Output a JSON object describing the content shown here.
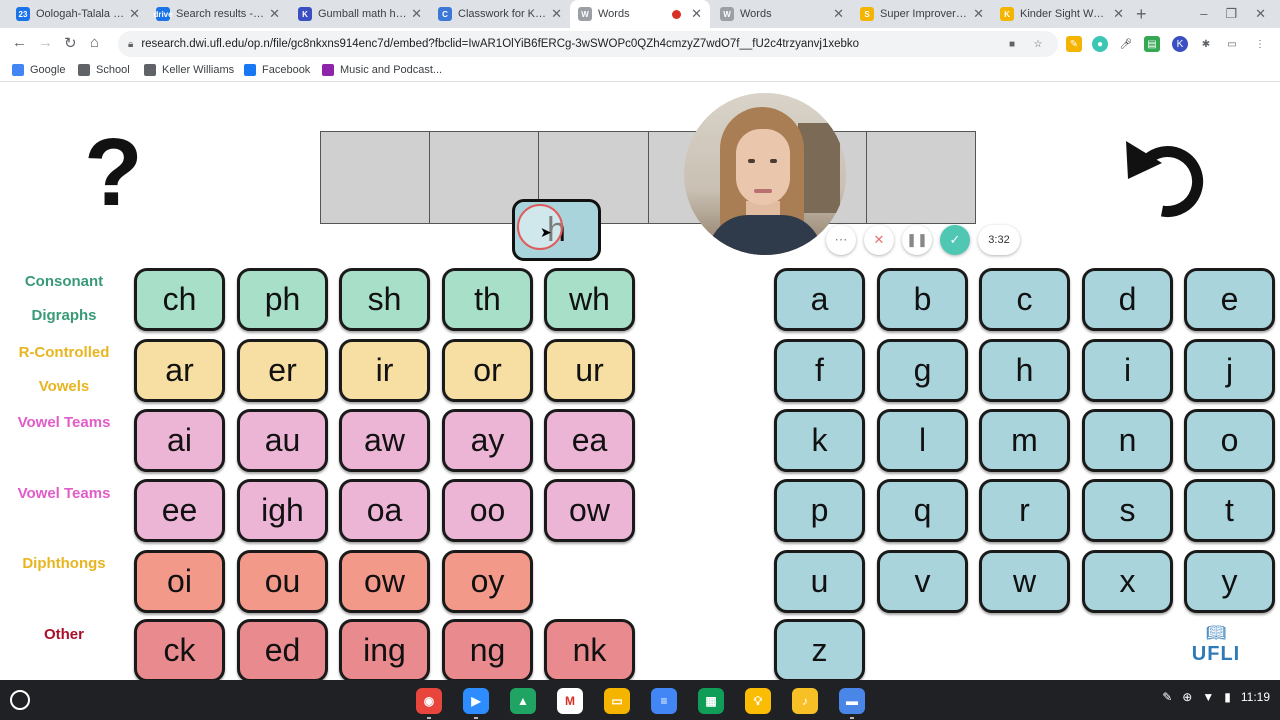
{
  "tabs": [
    {
      "title": "Oologah-Talala Pu",
      "favicon": "23",
      "color": "#1a73e8"
    },
    {
      "title": "Search results - Go",
      "favicon": "drive",
      "color": "#1a73e8"
    },
    {
      "title": "Gumball math hun",
      "favicon": "K",
      "color": "#3c4fc2"
    },
    {
      "title": "Classwork for Kind",
      "favicon": "C",
      "color": "#3c78d8"
    },
    {
      "title": "Words",
      "favicon": "W",
      "color": "#9aa0a6"
    },
    {
      "title": "Words",
      "favicon": "W",
      "color": "#9aa0a6"
    },
    {
      "title": "Super Improver W",
      "favicon": "S",
      "color": "#f4b400"
    },
    {
      "title": "Kinder Sight Words",
      "favicon": "K",
      "color": "#f4b400"
    }
  ],
  "window_controls": {
    "minimize": "–",
    "restore": "❐",
    "close": "✕"
  },
  "address": {
    "url": "research.dwi.ufl.edu/op.n/file/gc8nkxns914enc7d/embed?fbclid=IwAR1OlYiB6fERCg-3wSWOPc0QZh4cmzyZ7wdO7f__fU2c4trzyanvj1xebko"
  },
  "bookmarks": [
    {
      "label": "Google",
      "color": "#4285f4"
    },
    {
      "label": "School",
      "color": "#5f6368"
    },
    {
      "label": "Keller Williams",
      "color": "#5f6368"
    },
    {
      "label": "Facebook",
      "color": "#1877f2"
    },
    {
      "label": "Music and Podcast...",
      "color": "#8e24aa"
    }
  ],
  "board": {
    "help_symbol": "?",
    "dragging_tile": "h",
    "word_box_count": 6
  },
  "recorder": {
    "timer": "3:32"
  },
  "row_labels": [
    {
      "text": "Consonant",
      "color": "#3a9a78"
    },
    {
      "text": "Digraphs",
      "color": "#3a9a78"
    },
    {
      "text": "R-Controlled",
      "color": "#e8b520"
    },
    {
      "text": "Vowels",
      "color": "#e8b520"
    },
    {
      "text": "Vowel Teams",
      "color": "#e25cc8"
    },
    {
      "text": "Vowel Teams",
      "color": "#e25cc8"
    },
    {
      "text": "Diphthongs",
      "color": "#e8b520"
    },
    {
      "text": "Other",
      "color": "#a8102a"
    }
  ],
  "phonics_rows": [
    {
      "color": "green",
      "tiles": [
        "ch",
        "ph",
        "sh",
        "th",
        "wh"
      ]
    },
    {
      "color": "yellow",
      "tiles": [
        "ar",
        "er",
        "ir",
        "or",
        "ur"
      ]
    },
    {
      "color": "pink",
      "tiles": [
        "ai",
        "au",
        "aw",
        "ay",
        "ea"
      ]
    },
    {
      "color": "pink",
      "tiles": [
        "ee",
        "igh",
        "oa",
        "oo",
        "ow"
      ]
    },
    {
      "color": "salmon",
      "tiles": [
        "oi",
        "ou",
        "ow",
        "oy"
      ]
    },
    {
      "color": "rose",
      "tiles": [
        "ck",
        "ed",
        "ing",
        "ng",
        "nk"
      ]
    }
  ],
  "letters": [
    "a",
    "b",
    "c",
    "d",
    "e",
    "f",
    "g",
    "h",
    "i",
    "j",
    "k",
    "l",
    "m",
    "n",
    "o",
    "p",
    "q",
    "r",
    "s",
    "t",
    "u",
    "v",
    "w",
    "x",
    "y",
    "z"
  ],
  "logo": {
    "text": "UFLI"
  },
  "shelf": {
    "time": "11:19",
    "apps": [
      "chrome",
      "zoom",
      "drive",
      "gmail",
      "slides",
      "docs",
      "sheets",
      "keep",
      "audio",
      "files"
    ]
  }
}
